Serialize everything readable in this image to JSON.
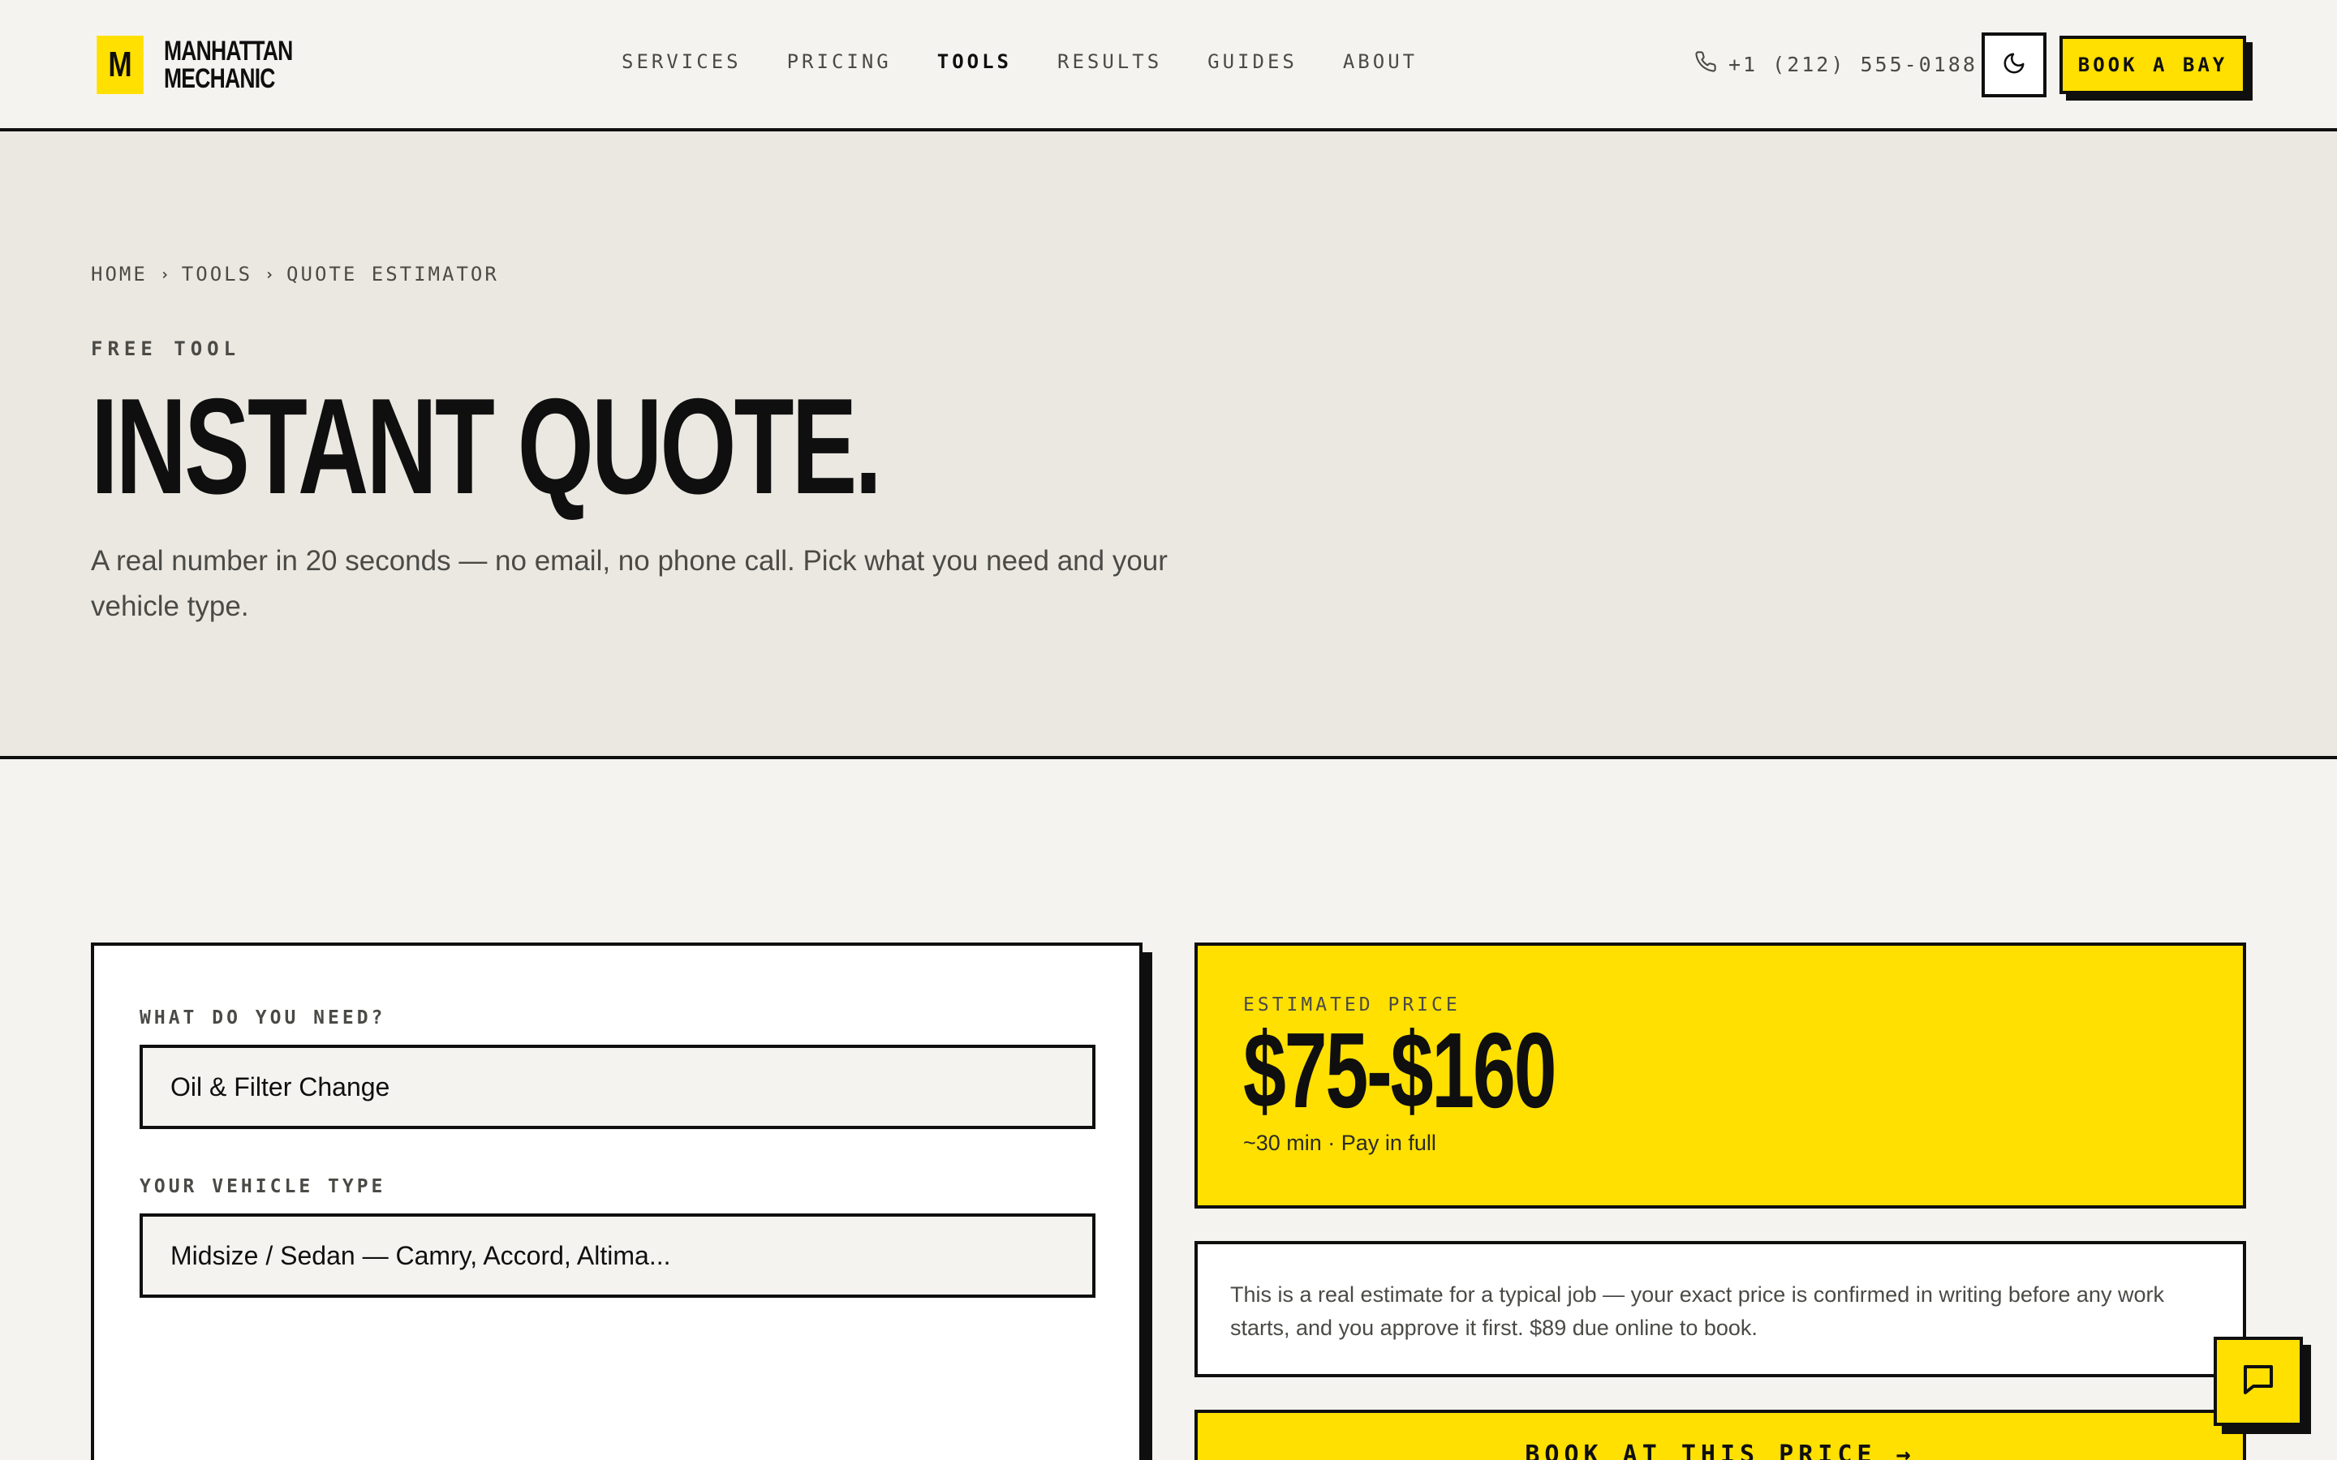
{
  "brand": {
    "mark": "M",
    "name": "MANHATTAN MECHANIC"
  },
  "nav": [
    {
      "label": "SERVICES",
      "active": false
    },
    {
      "label": "PRICING",
      "active": false
    },
    {
      "label": "TOOLS",
      "active": true
    },
    {
      "label": "RESULTS",
      "active": false
    },
    {
      "label": "GUIDES",
      "active": false
    },
    {
      "label": "ABOUT",
      "active": false
    }
  ],
  "header": {
    "phone": "+1 (212) 555-0188",
    "book_label": "BOOK A BAY",
    "theme_icon": "moon-icon",
    "phone_icon": "phone-icon"
  },
  "breadcrumb": [
    "HOME",
    "TOOLS",
    "QUOTE ESTIMATOR"
  ],
  "hero": {
    "eyebrow": "FREE TOOL",
    "title": "INSTANT QUOTE.",
    "subtitle": "A real number in 20 seconds — no email, no phone call. Pick what you need and your vehicle type."
  },
  "form": {
    "service_label": "WHAT DO YOU NEED?",
    "service_value": "Oil & Filter Change",
    "vehicle_label": "YOUR VEHICLE TYPE",
    "vehicle_value": "Midsize / Sedan — Camry, Accord, Altima..."
  },
  "estimate": {
    "label": "ESTIMATED PRICE",
    "price": "$75-$160",
    "meta": "~30 min · Pay in full",
    "note": "This is a real estimate for a typical job — your exact price is confirmed in writing before any work starts, and you approve it first. $89 due online to book.",
    "cta": "BOOK AT THIS PRICE →"
  },
  "colors": {
    "accent": "#ffe000",
    "ink": "#0f0f0f",
    "paper": "#f4f3ef",
    "hero_bg": "#ebe8e1"
  },
  "chat_icon": "chat-bubble-icon"
}
